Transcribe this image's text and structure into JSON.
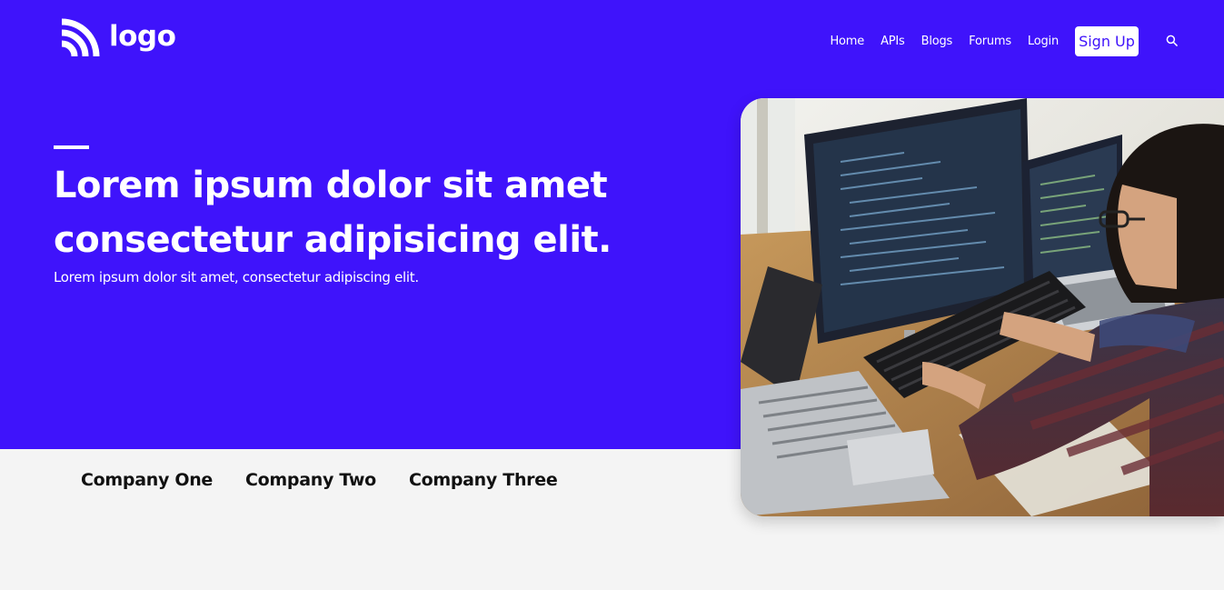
{
  "header": {
    "logo_text": "logo",
    "nav": [
      "Home",
      "APIs",
      "Blogs",
      "Forums",
      "Login"
    ],
    "signup_label": "Sign Up",
    "search_icon": "search-icon"
  },
  "hero": {
    "headline": "Lorem ipsum dolor sit amet consectetur adipisicing elit.",
    "subheadline": "Lorem ipsum dolor sit amet, consectetur adipiscing elit.",
    "image_icon": "developer-workstation-photo"
  },
  "companies": [
    "Company One",
    "Company Two",
    "Company Three"
  ],
  "colors": {
    "brand": "#3f13fb",
    "background": "#f4f4f4",
    "text_light": "#ffffff",
    "text_dark": "#111111"
  }
}
